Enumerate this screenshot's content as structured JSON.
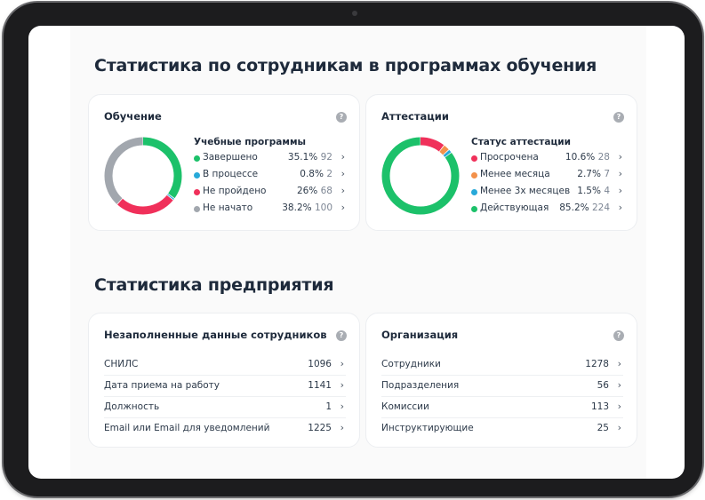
{
  "sections": {
    "training_title": "Статистика по сотрудникам в программах обучения",
    "enterprise_title": "Статистика предприятия"
  },
  "training": {
    "title": "Обучение",
    "legend_title": "Учебные программы",
    "items": [
      {
        "label": "Завершено",
        "pct": "35.1%",
        "count": "92",
        "color": "#1cc16a"
      },
      {
        "label": "В процессе",
        "pct": "0.8%",
        "count": "2",
        "color": "#27a9d9"
      },
      {
        "label": "Не пройдено",
        "pct": "26%",
        "count": "68",
        "color": "#f0305a"
      },
      {
        "label": "Не начато",
        "pct": "38.2%",
        "count": "100",
        "color": "#a2a7ae"
      }
    ]
  },
  "attestation": {
    "title": "Аттестации",
    "legend_title": "Статус аттестации",
    "items": [
      {
        "label": "Просрочена",
        "pct": "10.6%",
        "count": "28",
        "color": "#f0305a"
      },
      {
        "label": "Менее месяца",
        "pct": "2.7%",
        "count": "7",
        "color": "#f3914a"
      },
      {
        "label": "Менее 3х месяцев",
        "pct": "1.5%",
        "count": "4",
        "color": "#27a9d9"
      },
      {
        "label": "Действующая",
        "pct": "85.2%",
        "count": "224",
        "color": "#1cc16a"
      }
    ]
  },
  "missing_data": {
    "title": "Незаполненные данные сотрудников",
    "rows": [
      {
        "label": "СНИЛС",
        "value": "1096"
      },
      {
        "label": "Дата приема на работу",
        "value": "1141"
      },
      {
        "label": "Должность",
        "value": "1"
      },
      {
        "label": "Email или Email для уведомлений",
        "value": "1225"
      }
    ]
  },
  "organization": {
    "title": "Организация",
    "rows": [
      {
        "label": "Сотрудники",
        "value": "1278"
      },
      {
        "label": "Подразделения",
        "value": "56"
      },
      {
        "label": "Комиссии",
        "value": "113"
      },
      {
        "label": "Инструктирующие",
        "value": "25"
      }
    ]
  },
  "icons": {
    "help": "?",
    "chevron": "›"
  }
}
